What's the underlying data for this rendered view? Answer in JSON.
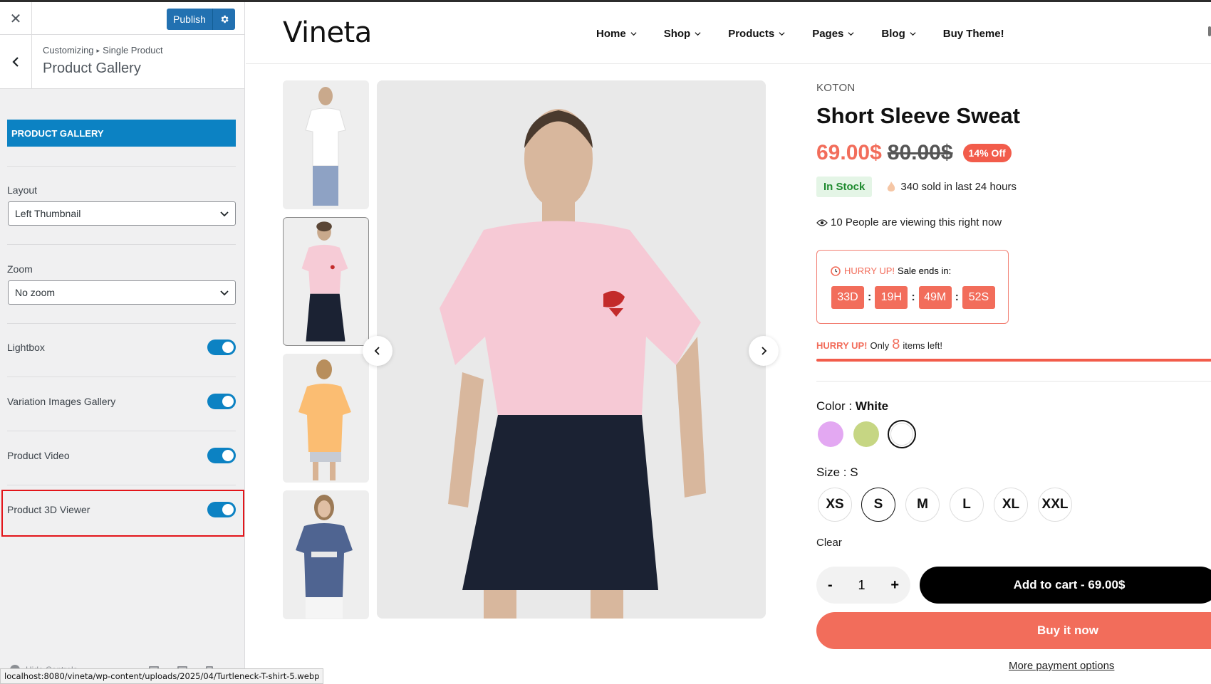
{
  "sidebar": {
    "publish_label": "Publish",
    "breadcrumb": {
      "root": "Customizing",
      "parent": "Single Product"
    },
    "section_title": "Product Gallery",
    "panel_heading": "PRODUCT GALLERY",
    "layout": {
      "label": "Layout",
      "value": "Left Thumbnail"
    },
    "zoom": {
      "label": "Zoom",
      "value": "No zoom"
    },
    "toggles": [
      {
        "label": "Lightbox",
        "on": true
      },
      {
        "label": "Variation Images Gallery",
        "on": true
      },
      {
        "label": "Product Video",
        "on": true
      },
      {
        "label": "Product 3D Viewer",
        "on": true
      }
    ],
    "hide_controls": "Hide Controls",
    "accent": "#0c82c3",
    "highlight_color": "#e3151a"
  },
  "status_url": "localhost:8080/vineta/wp-content/uploads/2025/04/Turtleneck-T-shirt-5.webp",
  "site": {
    "logo": "Vineta",
    "nav": [
      "Home",
      "Shop",
      "Products",
      "Pages",
      "Blog",
      "Buy Theme!"
    ]
  },
  "product": {
    "brand": "KOTON",
    "title": "Short Sleeve Sweat",
    "price": "69.00$",
    "old_price": "80.00$",
    "discount": "14% Off",
    "stock": "In Stock",
    "sold": "340 sold in last 24 hours",
    "viewing": "10 People are viewing this right now",
    "countdown": {
      "hurry": "HURRY UP!",
      "label": "Sale ends in:",
      "days": "33D",
      "hours": "19H",
      "minutes": "49M",
      "seconds": "52S"
    },
    "items_left": {
      "hurry": "HURRY UP!",
      "only": "Only",
      "count": "8",
      "suffix": "items left!"
    },
    "color": {
      "label": "Color :",
      "value": "White",
      "swatches": [
        "#e3a8f2",
        "#c6d683",
        "#ffffff"
      ]
    },
    "size": {
      "label": "Size :",
      "value": "S",
      "options": [
        "XS",
        "S",
        "M",
        "L",
        "XL",
        "XXL"
      ]
    },
    "clear": "Clear",
    "quantity": "1",
    "add_to_cart": "Add to cart - 69.00$",
    "buy_now": "Buy it now",
    "more_payment": "More payment options",
    "accent": "#f26d5b"
  }
}
